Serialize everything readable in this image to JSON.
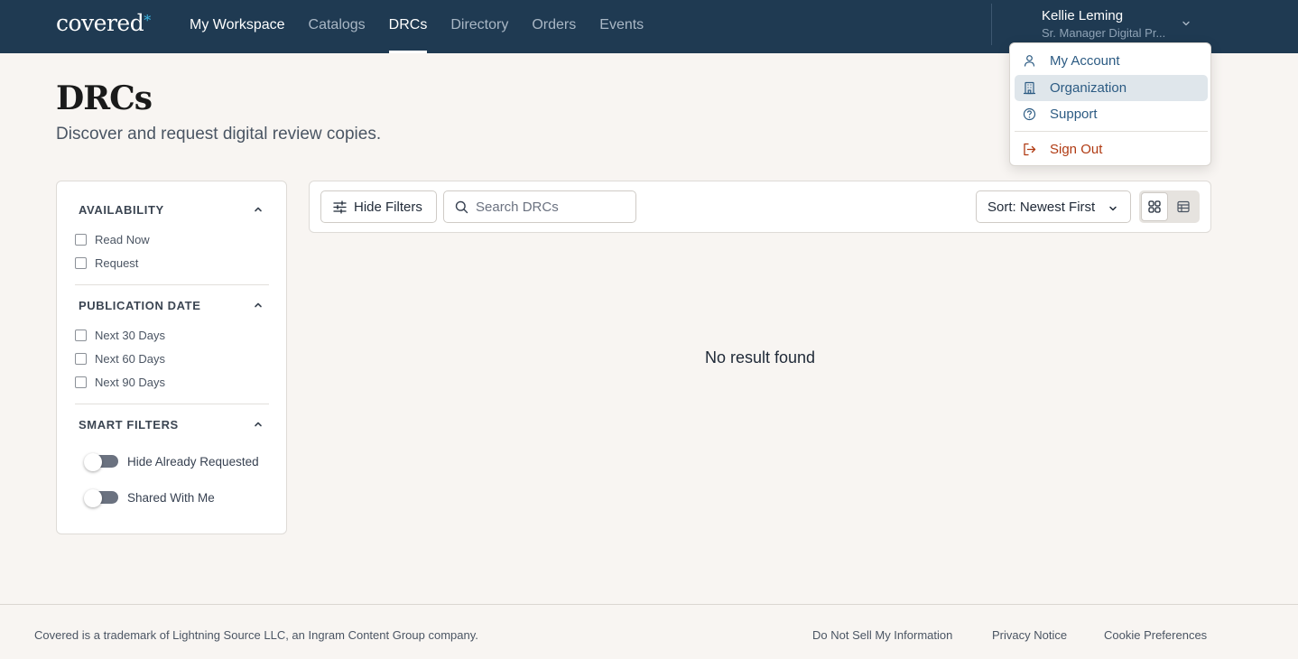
{
  "brand": {
    "name": "covered",
    "mark": "*"
  },
  "nav": {
    "items": [
      {
        "label": "My Workspace"
      },
      {
        "label": "Catalogs"
      },
      {
        "label": "DRCs"
      },
      {
        "label": "Directory"
      },
      {
        "label": "Orders"
      },
      {
        "label": "Events"
      }
    ],
    "active": "DRCs"
  },
  "user": {
    "name": "Kellie Leming",
    "role": "Sr. Manager Digital Pr..."
  },
  "user_menu": {
    "items": [
      {
        "label": "My Account",
        "icon": "user-icon"
      },
      {
        "label": "Organization",
        "icon": "building-icon"
      },
      {
        "label": "Support",
        "icon": "help-circle-icon"
      },
      {
        "label": "Sign Out",
        "icon": "sign-out-icon"
      }
    ],
    "highlighted": "Organization"
  },
  "header": {
    "title": "DRCs",
    "subtitle": "Discover and request digital review copies."
  },
  "filters": {
    "availability": {
      "title": "AVAILABILITY",
      "options": [
        "Read Now",
        "Request"
      ]
    },
    "publication_date": {
      "title": "PUBLICATION DATE",
      "options": [
        "Next 30 Days",
        "Next 60 Days",
        "Next 90 Days"
      ]
    },
    "smart_filters": {
      "title": "SMART FILTERS",
      "toggles": [
        "Hide Already Requested",
        "Shared With Me"
      ]
    }
  },
  "toolbar": {
    "hide_filters_label": "Hide Filters",
    "search_placeholder": "Search DRCs",
    "sort_label": "Sort: Newest First"
  },
  "results": {
    "empty_message": "No result found"
  },
  "footer": {
    "copyright": "Covered is a trademark of Lightning Source LLC, an Ingram Content Group company.",
    "links": [
      "Do Not Sell My Information",
      "Privacy Notice",
      "Cookie Preferences"
    ]
  },
  "colors": {
    "nav_bg": "#1f3a52",
    "page_bg": "#f8f5f2",
    "menu_link": "#2c5b83",
    "sign_out": "#b03a12",
    "accent_star": "#3db7e4"
  }
}
